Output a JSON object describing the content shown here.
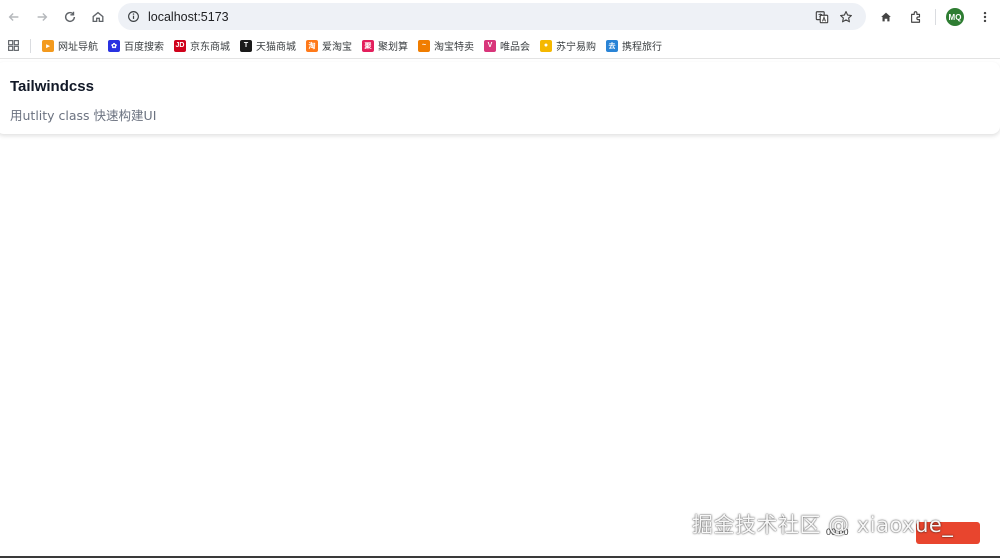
{
  "browser": {
    "url": "localhost:5173",
    "avatar_initials": "MQ"
  },
  "bookmarks": [
    {
      "label": "网址导航",
      "color": "#f39a1e",
      "glyph": "▸"
    },
    {
      "label": "百度搜索",
      "color": "#2932e1",
      "glyph": "✿"
    },
    {
      "label": "京东商城",
      "color": "#d0021b",
      "glyph": "JD"
    },
    {
      "label": "天猫商城",
      "color": "#1a1a1a",
      "glyph": "T"
    },
    {
      "label": "爱淘宝",
      "color": "#ff7a1a",
      "glyph": "淘"
    },
    {
      "label": "聚划算",
      "color": "#e31f5c",
      "glyph": "聚"
    },
    {
      "label": "淘宝特卖",
      "color": "#f07d00",
      "glyph": "~"
    },
    {
      "label": "唯品会",
      "color": "#d8357a",
      "glyph": "V"
    },
    {
      "label": "苏宁易购",
      "color": "#f5b800",
      "glyph": "●"
    },
    {
      "label": "携程旅行",
      "color": "#2a84d6",
      "glyph": "去"
    }
  ],
  "card": {
    "title": "Tailwindcss",
    "subtitle": "用utlity class 快速构建UI"
  },
  "overlay": {
    "watermark": "掘金技术社区 @ xiaoxue_",
    "timer": "00:00"
  }
}
